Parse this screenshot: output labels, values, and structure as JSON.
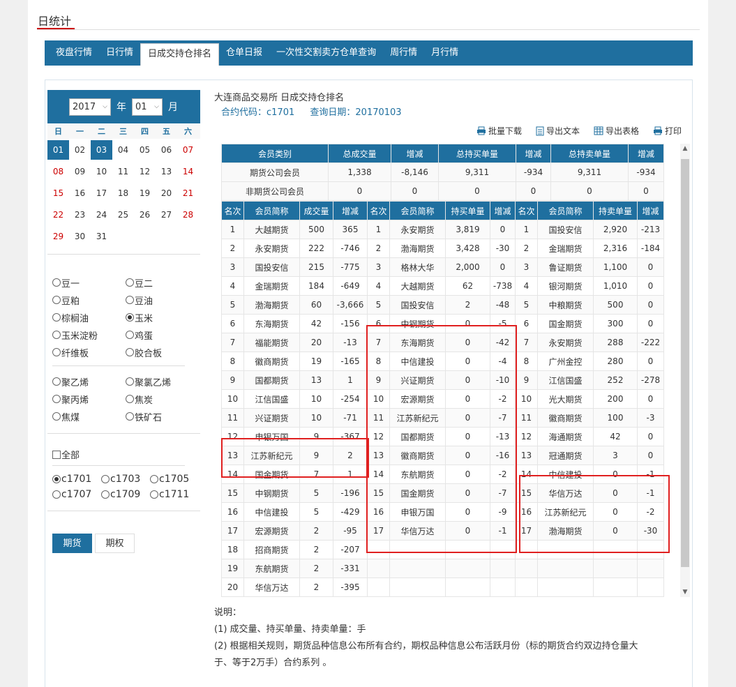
{
  "page": {
    "title": "日统计"
  },
  "tabs": [
    {
      "label": "夜盘行情",
      "active": false
    },
    {
      "label": "日行情",
      "active": false
    },
    {
      "label": "日成交持仓排名",
      "active": true
    },
    {
      "label": "仓单日报",
      "active": false
    },
    {
      "label": "一次性交割卖方仓单查询",
      "active": false
    },
    {
      "label": "周行情",
      "active": false
    },
    {
      "label": "月行情",
      "active": false
    }
  ],
  "calendar": {
    "year": "2017",
    "year_suffix": "年",
    "month": "01",
    "month_suffix": "月",
    "weekdays": [
      "日",
      "一",
      "二",
      "三",
      "四",
      "五",
      "六"
    ],
    "weeks": [
      [
        "01",
        "02",
        "03",
        "04",
        "05",
        "06",
        "07"
      ],
      [
        "08",
        "09",
        "10",
        "11",
        "12",
        "13",
        "14"
      ],
      [
        "15",
        "16",
        "17",
        "18",
        "19",
        "20",
        "21"
      ],
      [
        "22",
        "23",
        "24",
        "25",
        "26",
        "27",
        "28"
      ],
      [
        "29",
        "30",
        "31",
        "",
        "",
        "",
        ""
      ]
    ],
    "selected_days": [
      "01",
      "03"
    ]
  },
  "products_group1": [
    {
      "label": "豆一",
      "checked": false
    },
    {
      "label": "豆二",
      "checked": false
    },
    {
      "label": "豆粕",
      "checked": false
    },
    {
      "label": "豆油",
      "checked": false
    },
    {
      "label": "棕榈油",
      "checked": false
    },
    {
      "label": "玉米",
      "checked": true
    },
    {
      "label": "玉米淀粉",
      "checked": false
    },
    {
      "label": "鸡蛋",
      "checked": false
    },
    {
      "label": "纤维板",
      "checked": false
    },
    {
      "label": "胶合板",
      "checked": false
    }
  ],
  "products_group2": [
    {
      "label": "聚乙烯",
      "checked": false
    },
    {
      "label": "聚氯乙烯",
      "checked": false
    },
    {
      "label": "聚丙烯",
      "checked": false
    },
    {
      "label": "焦炭",
      "checked": false
    },
    {
      "label": "焦煤",
      "checked": false
    },
    {
      "label": "铁矿石",
      "checked": false
    }
  ],
  "all_label": "全部",
  "contracts": [
    {
      "label": "c1701",
      "checked": true
    },
    {
      "label": "c1703",
      "checked": false
    },
    {
      "label": "c1705",
      "checked": false
    },
    {
      "label": "c1707",
      "checked": false
    },
    {
      "label": "c1709",
      "checked": false
    },
    {
      "label": "c1711",
      "checked": false
    }
  ],
  "type_tabs": {
    "futures": "期货",
    "options": "期权"
  },
  "header": {
    "exchange_line": "大连商品交易所 日成交持仓排名",
    "contract_label": "合约代码：",
    "contract": "c1701",
    "date_label": "查询日期：",
    "date": "20170103"
  },
  "toolbar": {
    "batch_download": "批量下载",
    "export_text": "导出文本",
    "export_table": "导出表格",
    "print": "打印"
  },
  "summary": {
    "headers": [
      "会员类别",
      "总成交量",
      "增减",
      "总持买单量",
      "增减",
      "总持卖单量",
      "增减"
    ],
    "rows": [
      [
        "期货公司会员",
        "1,338",
        "-8,146",
        "9,311",
        "-934",
        "9,311",
        "-934"
      ],
      [
        "非期货公司会员",
        "0",
        "0",
        "0",
        "0",
        "0",
        "0"
      ]
    ]
  },
  "ranking": {
    "headers": [
      "名次",
      "会员简称",
      "成交量",
      "增减",
      "名次",
      "会员简称",
      "持买单量",
      "增减",
      "名次",
      "会员简称",
      "持卖单量",
      "增减"
    ],
    "rows": [
      [
        "1",
        "大越期货",
        "500",
        "365",
        "1",
        "永安期货",
        "3,819",
        "0",
        "1",
        "国投安信",
        "2,920",
        "-213"
      ],
      [
        "2",
        "永安期货",
        "222",
        "-746",
        "2",
        "渤海期货",
        "3,428",
        "-30",
        "2",
        "金瑞期货",
        "2,316",
        "-184"
      ],
      [
        "3",
        "国投安信",
        "215",
        "-775",
        "3",
        "格林大华",
        "2,000",
        "0",
        "3",
        "鲁证期货",
        "1,100",
        "0"
      ],
      [
        "4",
        "金瑞期货",
        "184",
        "-649",
        "4",
        "大越期货",
        "62",
        "-738",
        "4",
        "银河期货",
        "1,010",
        "0"
      ],
      [
        "5",
        "渤海期货",
        "60",
        "-3,666",
        "5",
        "国投安信",
        "2",
        "-48",
        "5",
        "中粮期货",
        "500",
        "0"
      ],
      [
        "6",
        "东海期货",
        "42",
        "-156",
        "6",
        "中钢期货",
        "0",
        "-5",
        "6",
        "国金期货",
        "300",
        "0"
      ],
      [
        "7",
        "福能期货",
        "20",
        "-13",
        "7",
        "东海期货",
        "0",
        "-42",
        "7",
        "永安期货",
        "288",
        "-222"
      ],
      [
        "8",
        "徽商期货",
        "19",
        "-165",
        "8",
        "中信建投",
        "0",
        "-4",
        "8",
        "广州金控",
        "280",
        "0"
      ],
      [
        "9",
        "国都期货",
        "13",
        "1",
        "9",
        "兴证期货",
        "0",
        "-10",
        "9",
        "江信国盛",
        "252",
        "-278"
      ],
      [
        "10",
        "江信国盛",
        "10",
        "-254",
        "10",
        "宏源期货",
        "0",
        "-2",
        "10",
        "光大期货",
        "200",
        "0"
      ],
      [
        "11",
        "兴证期货",
        "10",
        "-71",
        "11",
        "江苏新纪元",
        "0",
        "-7",
        "11",
        "徽商期货",
        "100",
        "-3"
      ],
      [
        "12",
        "申银万国",
        "9",
        "-367",
        "12",
        "国都期货",
        "0",
        "-13",
        "12",
        "海通期货",
        "42",
        "0"
      ],
      [
        "13",
        "江苏新纪元",
        "9",
        "2",
        "13",
        "徽商期货",
        "0",
        "-16",
        "13",
        "冠通期货",
        "3",
        "0"
      ],
      [
        "14",
        "国金期货",
        "7",
        "1",
        "14",
        "东航期货",
        "0",
        "-2",
        "14",
        "中信建投",
        "0",
        "-1"
      ],
      [
        "15",
        "中钢期货",
        "5",
        "-196",
        "15",
        "国金期货",
        "0",
        "-7",
        "15",
        "华信万达",
        "0",
        "-1"
      ],
      [
        "16",
        "中信建投",
        "5",
        "-429",
        "16",
        "申银万国",
        "0",
        "-9",
        "16",
        "江苏新纪元",
        "0",
        "-2"
      ],
      [
        "17",
        "宏源期货",
        "2",
        "-95",
        "17",
        "华信万达",
        "0",
        "-1",
        "17",
        "渤海期货",
        "0",
        "-30"
      ],
      [
        "18",
        "招商期货",
        "2",
        "-207",
        "",
        "",
        "",
        "",
        "",
        "",
        "",
        ""
      ],
      [
        "19",
        "东航期货",
        "2",
        "-331",
        "",
        "",
        "",
        "",
        "",
        "",
        "",
        ""
      ],
      [
        "20",
        "华信万达",
        "2",
        "-395",
        "",
        "",
        "",
        "",
        "",
        "",
        "",
        ""
      ]
    ]
  },
  "notes": {
    "title": "说明：",
    "line1": "(1) 成交量、持买单量、持卖单量：手",
    "line2": "(2) 根据相关规则，期货品种信息公布所有合约，期权品种信息公布活跃月份（标的期货合约双边持仓量大",
    "line3": "于、等于2万手）合约系列 。"
  },
  "colors": {
    "accent": "#1f6f9f",
    "weekend": "#cc0000",
    "highlight_box": "#e02020"
  }
}
